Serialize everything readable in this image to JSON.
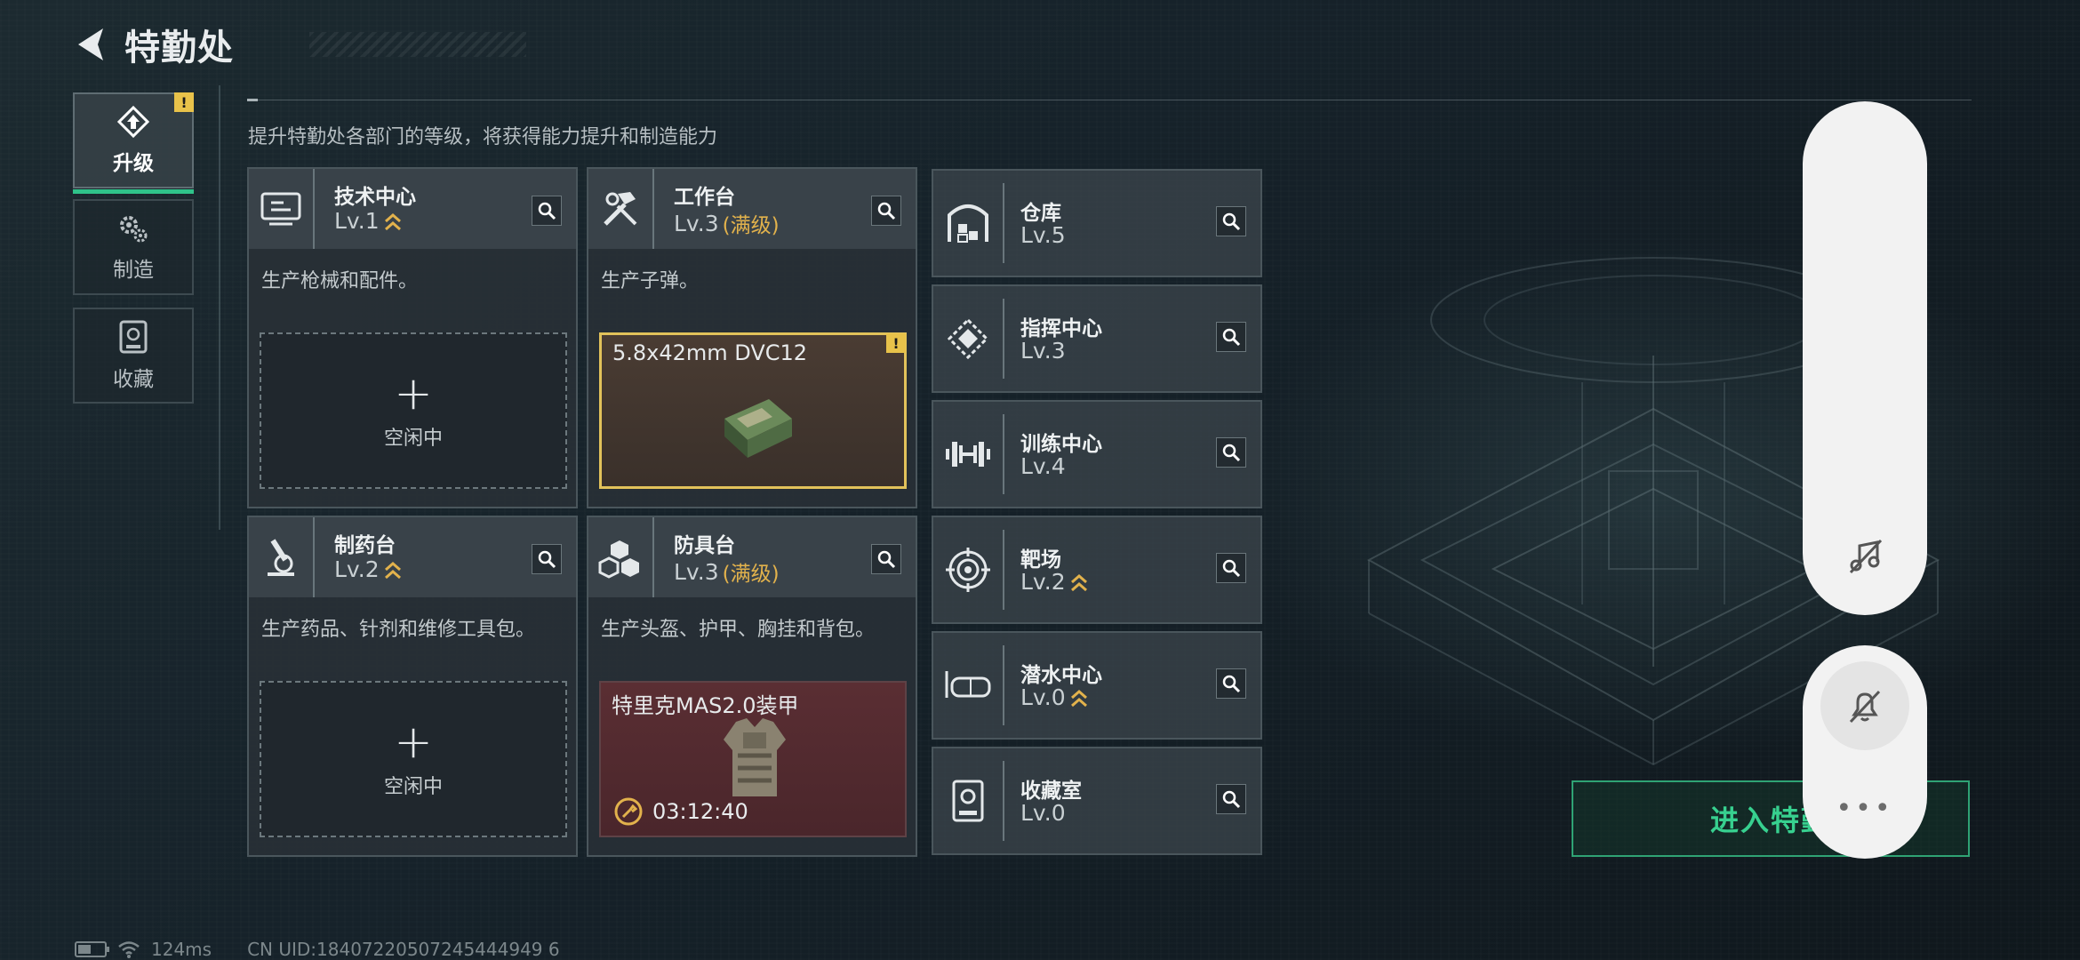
{
  "header": {
    "title": "特勤处"
  },
  "side_tabs": [
    {
      "label": "升级",
      "active": true,
      "badge": "!"
    },
    {
      "label": "制造",
      "active": false
    },
    {
      "label": "收藏",
      "active": false
    }
  ],
  "subtitle": "提升特勤处各部门的等级，将获得能力提升和制造能力",
  "facilities": {
    "tech_center": {
      "name": "技术中心",
      "level": "Lv.1",
      "upgradable": true,
      "description": "生产枪械和配件。",
      "slot": {
        "state": "空闲中",
        "plus": "+"
      }
    },
    "workbench": {
      "name": "工作台",
      "level": "Lv.3",
      "max_label": "(满级)",
      "description": "生产子弹。",
      "production": {
        "item": "5.8x42mm DVC12",
        "badge": "!"
      }
    },
    "pharmacy": {
      "name": "制药台",
      "level": "Lv.2",
      "upgradable": true,
      "description": "生产药品、针剂和维修工具包。",
      "slot": {
        "state": "空闲中",
        "plus": "+"
      }
    },
    "armor_bench": {
      "name": "防具台",
      "level": "Lv.3",
      "max_label": "(满级)",
      "description": "生产头盔、护甲、胸挂和背包。",
      "production": {
        "item": "特里克MAS2.0装甲",
        "timer": "03:12:40"
      }
    },
    "warehouse": {
      "name": "仓库",
      "level": "Lv.5",
      "upgradable": false
    },
    "command_center": {
      "name": "指挥中心",
      "level": "Lv.3",
      "upgradable": false
    },
    "training_center": {
      "name": "训练中心",
      "level": "Lv.4",
      "upgradable": false
    },
    "shooting_range": {
      "name": "靶场",
      "level": "Lv.2",
      "upgradable": true
    },
    "diving_center": {
      "name": "潜水中心",
      "level": "Lv.0",
      "upgradable": true
    },
    "collection_room": {
      "name": "收藏室",
      "level": "Lv.0",
      "upgradable": false
    }
  },
  "enter_button": {
    "label": "进入特勤"
  },
  "floating_panel": {
    "more": "•••"
  },
  "footer": {
    "ping": "124ms",
    "uid": "CN UID:18407220507245444949 6"
  },
  "colors": {
    "accent_green": "#2fc38a",
    "gold": "#e2b24c",
    "warning_yellow": "#e8c24a"
  }
}
